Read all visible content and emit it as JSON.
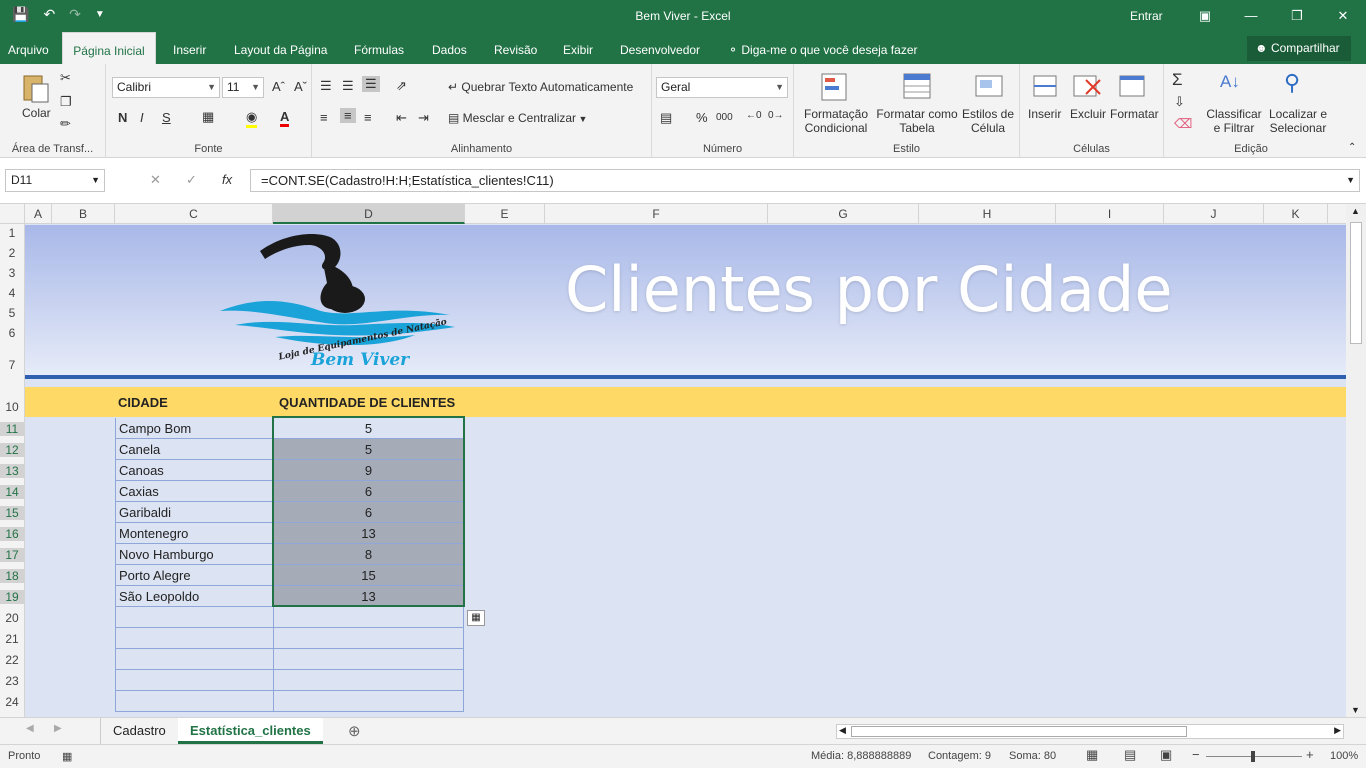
{
  "titlebar": {
    "title": "Bem Viver  -  Excel",
    "signin": "Entrar",
    "save_icon": "save-icon",
    "undo_icon": "undo-icon",
    "redo_icon": "redo-icon"
  },
  "tabs": [
    "Arquivo",
    "Página Inicial",
    "Inserir",
    "Layout da Página",
    "Fórmulas",
    "Dados",
    "Revisão",
    "Exibir",
    "Desenvolvedor"
  ],
  "active_tab": "Página Inicial",
  "tell_me": "Diga-me o que você deseja fazer",
  "share": "Compartilhar",
  "ribbon": {
    "clipboard": {
      "paste": "Colar",
      "label": "Área de Transf..."
    },
    "font": {
      "name": "Calibri",
      "size": "11",
      "bold": "N",
      "italic": "I",
      "underline": "S",
      "label": "Fonte"
    },
    "alignment": {
      "wrap": "Quebrar Texto Automaticamente",
      "merge": "Mesclar e Centralizar",
      "label": "Alinhamento"
    },
    "number": {
      "format": "Geral",
      "percent": "%",
      "thousands": "000",
      "label": "Número"
    },
    "styles": {
      "conditional_1": "Formatação",
      "conditional_2": "Condicional",
      "table_1": "Formatar como",
      "table_2": "Tabela",
      "cell_1": "Estilos de",
      "cell_2": "Célula",
      "label": "Estilo"
    },
    "cells": {
      "insert": "Inserir",
      "delete": "Excluir",
      "format": "Formatar",
      "label": "Células"
    },
    "editing": {
      "sort_1": "Classificar",
      "sort_2": "e Filtrar",
      "find_1": "Localizar e",
      "find_2": "Selecionar",
      "label": "Edição"
    }
  },
  "formula_bar": {
    "name_box": "D11",
    "fx": "fx",
    "formula": "=CONT.SE(Cadastro!H:H;Estatística_clientes!C11)"
  },
  "columns": [
    "A",
    "B",
    "C",
    "D",
    "E",
    "F",
    "G",
    "H",
    "I",
    "J",
    "K"
  ],
  "rows": [
    "1",
    "2",
    "3",
    "4",
    "5",
    "6",
    "7",
    "10",
    "11",
    "12",
    "13",
    "14",
    "15",
    "16",
    "17",
    "18",
    "19",
    "20",
    "21",
    "22",
    "23",
    "24"
  ],
  "banner": {
    "title": "Clientes por Cidade",
    "logo_line1": "Loja de Equipamentos de Natação",
    "logo_line2": "Bem Viver"
  },
  "table": {
    "header_city": "CIDADE",
    "header_count": "QUANTIDADE DE CLIENTES",
    "rows": [
      {
        "city": "Campo Bom",
        "count": "5"
      },
      {
        "city": "Canela",
        "count": "5"
      },
      {
        "city": "Canoas",
        "count": "9"
      },
      {
        "city": "Caxias",
        "count": "6"
      },
      {
        "city": "Garibaldi",
        "count": "6"
      },
      {
        "city": "Montenegro",
        "count": "13"
      },
      {
        "city": "Novo Hamburgo",
        "count": "8"
      },
      {
        "city": "Porto Alegre",
        "count": "15"
      },
      {
        "city": "São Leopoldo",
        "count": "13"
      }
    ]
  },
  "sheets": [
    "Cadastro",
    "Estatística_clientes"
  ],
  "active_sheet": "Estatística_clientes",
  "status": {
    "ready": "Pronto",
    "average": "Média: 8,888888889",
    "count": "Contagem: 9",
    "sum": "Soma: 80",
    "zoom": "100%"
  }
}
